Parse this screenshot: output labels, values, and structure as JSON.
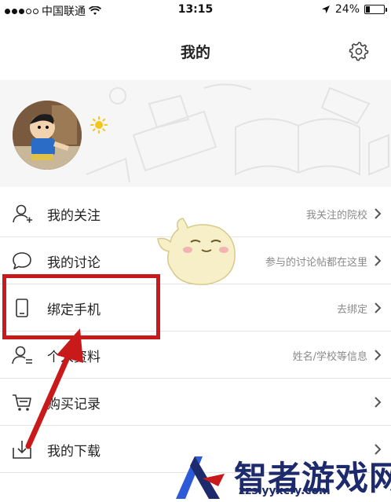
{
  "status_bar": {
    "carrier": "中国联通",
    "time": "13:15",
    "battery": "24%",
    "battery_level": 0.24,
    "signal_bars_filled": 3,
    "signal_bars_total": 5
  },
  "nav": {
    "title": "我的",
    "settings_icon": "gear-icon"
  },
  "profile": {
    "avatar_icon": "avatar",
    "badge_icon": "sun-icon"
  },
  "menu": {
    "items": [
      {
        "label": "我的关注",
        "hint": "我关注的院校",
        "icon": "user-add-icon"
      },
      {
        "label": "我的讨论",
        "hint": "参与的讨论帖都在这里",
        "icon": "chat-bubble-icon"
      },
      {
        "label": "绑定手机",
        "hint": "去绑定",
        "icon": "phone-icon"
      },
      {
        "label": "个人资料",
        "hint": "姓名/学校等信息",
        "icon": "profile-card-icon"
      },
      {
        "label": "购买记录",
        "hint": "",
        "icon": "cart-icon"
      },
      {
        "label": "我的下载",
        "hint": "",
        "icon": "download-icon"
      }
    ]
  },
  "watermark": {
    "title": "智者游戏网",
    "subtitle": "zzslyyxcfy.com"
  },
  "colors": {
    "annotation_red": "#c81a1a",
    "watermark_blue": "#1d2a6b",
    "hint_gray": "#8a8a8a"
  }
}
